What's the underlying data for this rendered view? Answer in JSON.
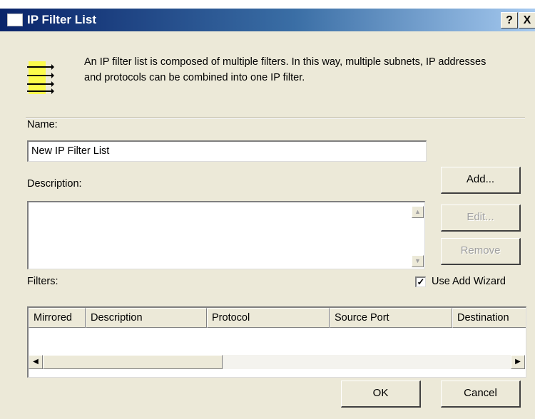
{
  "window": {
    "title": "IP Filter List",
    "help_label": "?",
    "close_label": "X"
  },
  "intro": {
    "text": "An IP filter list is composed of multiple filters. In this way, multiple subnets, IP addresses and protocols can be combined into one IP filter."
  },
  "name": {
    "label": "Name:",
    "value": "New IP Filter List"
  },
  "description": {
    "label": "Description:",
    "value": ""
  },
  "buttons": {
    "add": "Add...",
    "edit": "Edit...",
    "remove": "Remove",
    "ok": "OK",
    "cancel": "Cancel"
  },
  "filters": {
    "label": "Filters:",
    "use_add_wizard_label": "Use Add Wizard",
    "use_add_wizard_checked": true,
    "columns": [
      "Mirrored",
      "Description",
      "Protocol",
      "Source Port",
      "Destination"
    ],
    "rows": []
  },
  "colors": {
    "titlebar_start": "#0a246a",
    "titlebar_end": "#a6caf0",
    "dialog_bg": "#ece9d8"
  }
}
